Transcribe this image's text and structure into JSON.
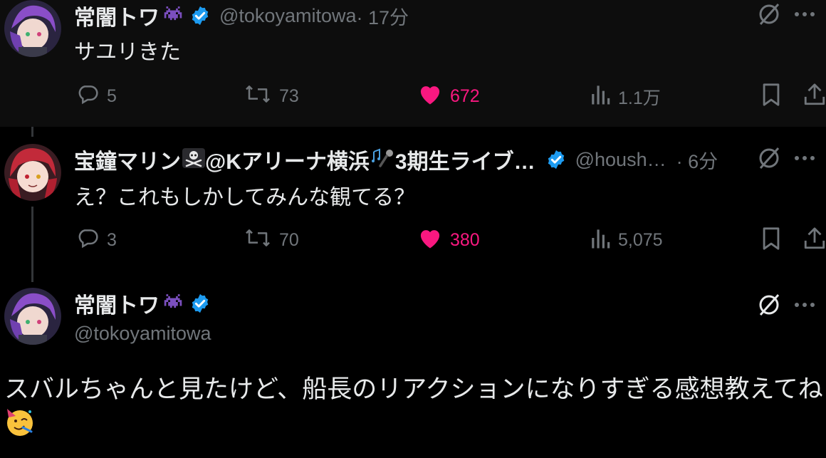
{
  "tweets": [
    {
      "author_name": "常闇トワ",
      "handle": "@tokoyamitowa",
      "time": " · 17分",
      "text": "サユリきた",
      "stats": {
        "replies": "5",
        "reposts": "73",
        "likes": "672",
        "views": "1.1万"
      },
      "liked": true
    },
    {
      "author_name": "宝鐘マリン",
      "name_mid": "@Kアリーナ横浜",
      "name_tail": "3期生ライブ…",
      "handle": "@housh…",
      "time": " · 6分",
      "text": "え？これもしかしてみんな観てる？",
      "stats": {
        "replies": "3",
        "reposts": "70",
        "likes": "380",
        "views": "5,075"
      },
      "liked": true
    },
    {
      "author_name": "常闇トワ",
      "handle": "@tokoyamitowa",
      "text": "スバルちゃんと見たけど、船長のリアクションになりすぎる感想教えてね"
    }
  ],
  "colors": {
    "accent_like": "#f91880",
    "verified": "#1d9bf0",
    "muted": "#71767b",
    "text": "#e7e9ea"
  },
  "icons": [
    "reply-icon",
    "repost-icon",
    "like-icon",
    "views-icon",
    "bookmark-icon",
    "share-icon",
    "grok-icon",
    "more-icon",
    "verified-icon"
  ]
}
